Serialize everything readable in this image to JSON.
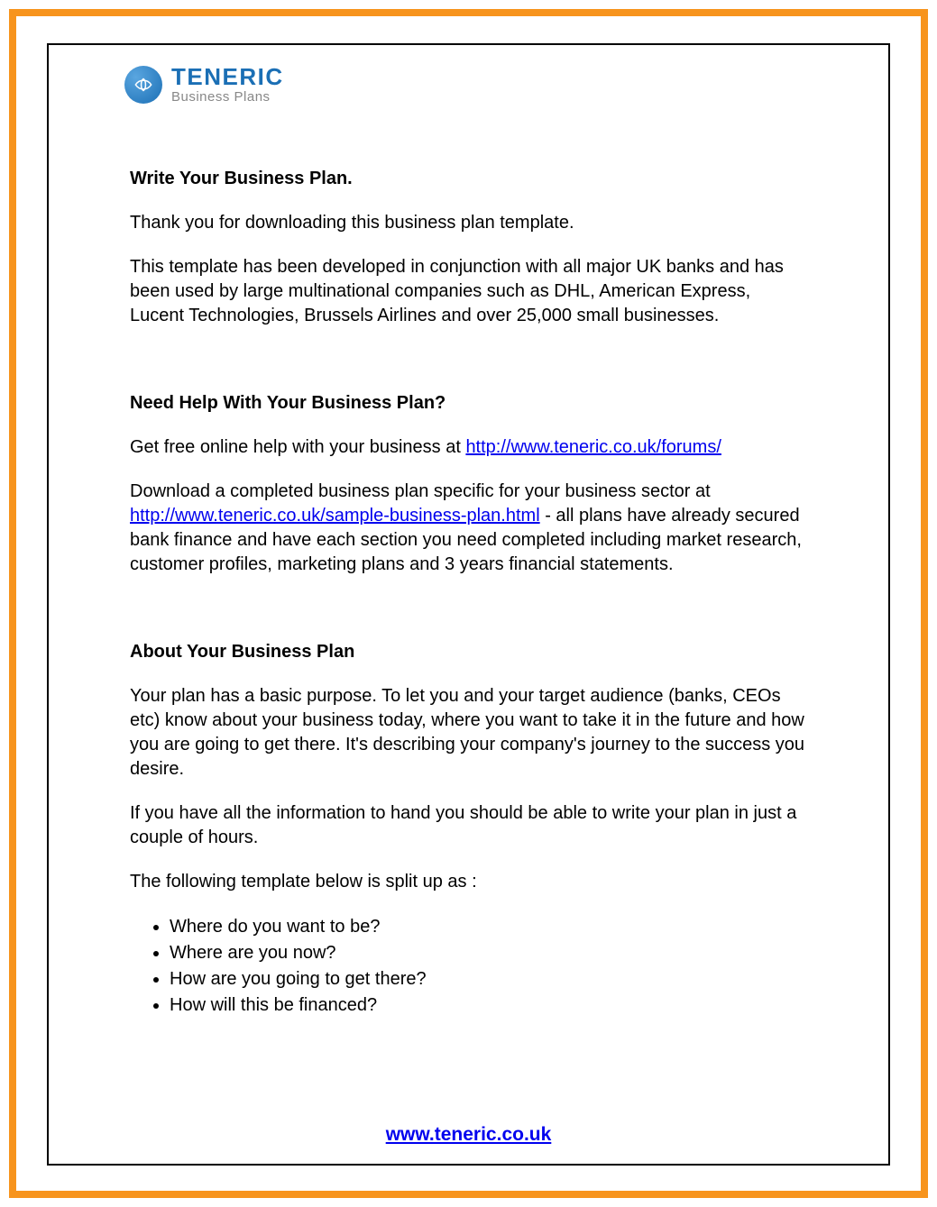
{
  "logo": {
    "name": "TENERIC",
    "tagline": "Business Plans"
  },
  "sections": {
    "write": {
      "heading": "Write Your Business Plan.",
      "p1": "Thank you for downloading this business plan template.",
      "p2": "This template has been developed in conjunction with all major UK banks and has been used by large multinational companies such as DHL, American Express, Lucent Technologies, Brussels Airlines and over 25,000 small businesses."
    },
    "help": {
      "heading": "Need Help With Your Business Plan?",
      "p1_prefix": "Get free online help with your business at ",
      "p1_link": "http://www.teneric.co.uk/forums/",
      "p2_prefix": "Download a completed business plan specific for your business sector at ",
      "p2_link": "http://www.teneric.co.uk/sample-business-plan.html",
      "p2_suffix": " - all plans have already secured bank finance and have each section you need completed including market research, customer profiles, marketing plans and 3 years financial statements."
    },
    "about": {
      "heading": "About Your Business Plan",
      "p1": "Your plan has a basic purpose. To let you and your target audience (banks, CEOs etc) know about your business today, where you want to take it in the future and how you are going to get there. It's describing your company's journey to the success you desire.",
      "p2": "If you have all the information to hand you should be able to write your plan in just a couple of hours.",
      "p3": "The following template below is split up as :",
      "bullets": [
        "Where do you want to be?",
        "Where are you now?",
        "How are you going to get there?",
        "How will this be financed?"
      ]
    }
  },
  "footer": {
    "url": "www.teneric.co.uk"
  }
}
